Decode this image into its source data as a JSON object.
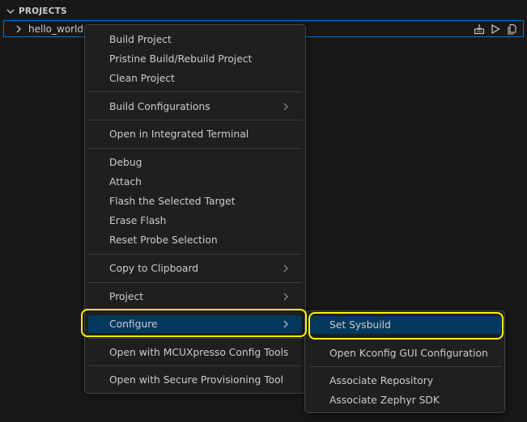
{
  "section": {
    "title": "PROJECTS"
  },
  "project": {
    "name": "hello_world"
  },
  "menu": {
    "items": [
      {
        "label": "Build Project"
      },
      {
        "label": "Pristine Build/Rebuild Project"
      },
      {
        "label": "Clean Project"
      },
      {
        "label": "Build Configurations"
      },
      {
        "label": "Open in Integrated Terminal"
      },
      {
        "label": "Debug"
      },
      {
        "label": "Attach"
      },
      {
        "label": "Flash the Selected Target"
      },
      {
        "label": "Erase Flash"
      },
      {
        "label": "Reset Probe Selection"
      },
      {
        "label": "Copy to Clipboard"
      },
      {
        "label": "Project"
      },
      {
        "label": "Configure"
      },
      {
        "label": "Open with MCUXpresso Config Tools"
      },
      {
        "label": "Open with Secure Provisioning Tool"
      }
    ]
  },
  "submenu": {
    "items": [
      {
        "label": "Set Sysbuild"
      },
      {
        "label": "Open Kconfig GUI Configuration"
      },
      {
        "label": "Associate Repository"
      },
      {
        "label": "Associate Zephyr SDK"
      }
    ]
  },
  "icons": {
    "section_chevron": "chevron-down-icon",
    "row_chevron": "chevron-right-icon",
    "actions": [
      "import-icon",
      "run-icon",
      "copy-icon"
    ],
    "submenu_arrow": "chevron-right-icon"
  },
  "colors": {
    "background": "#181818",
    "menu_background": "#1f1f1f",
    "selection_border": "#0078d4",
    "highlight_annotation": "#f5f50a",
    "active_item": "#04395e"
  }
}
